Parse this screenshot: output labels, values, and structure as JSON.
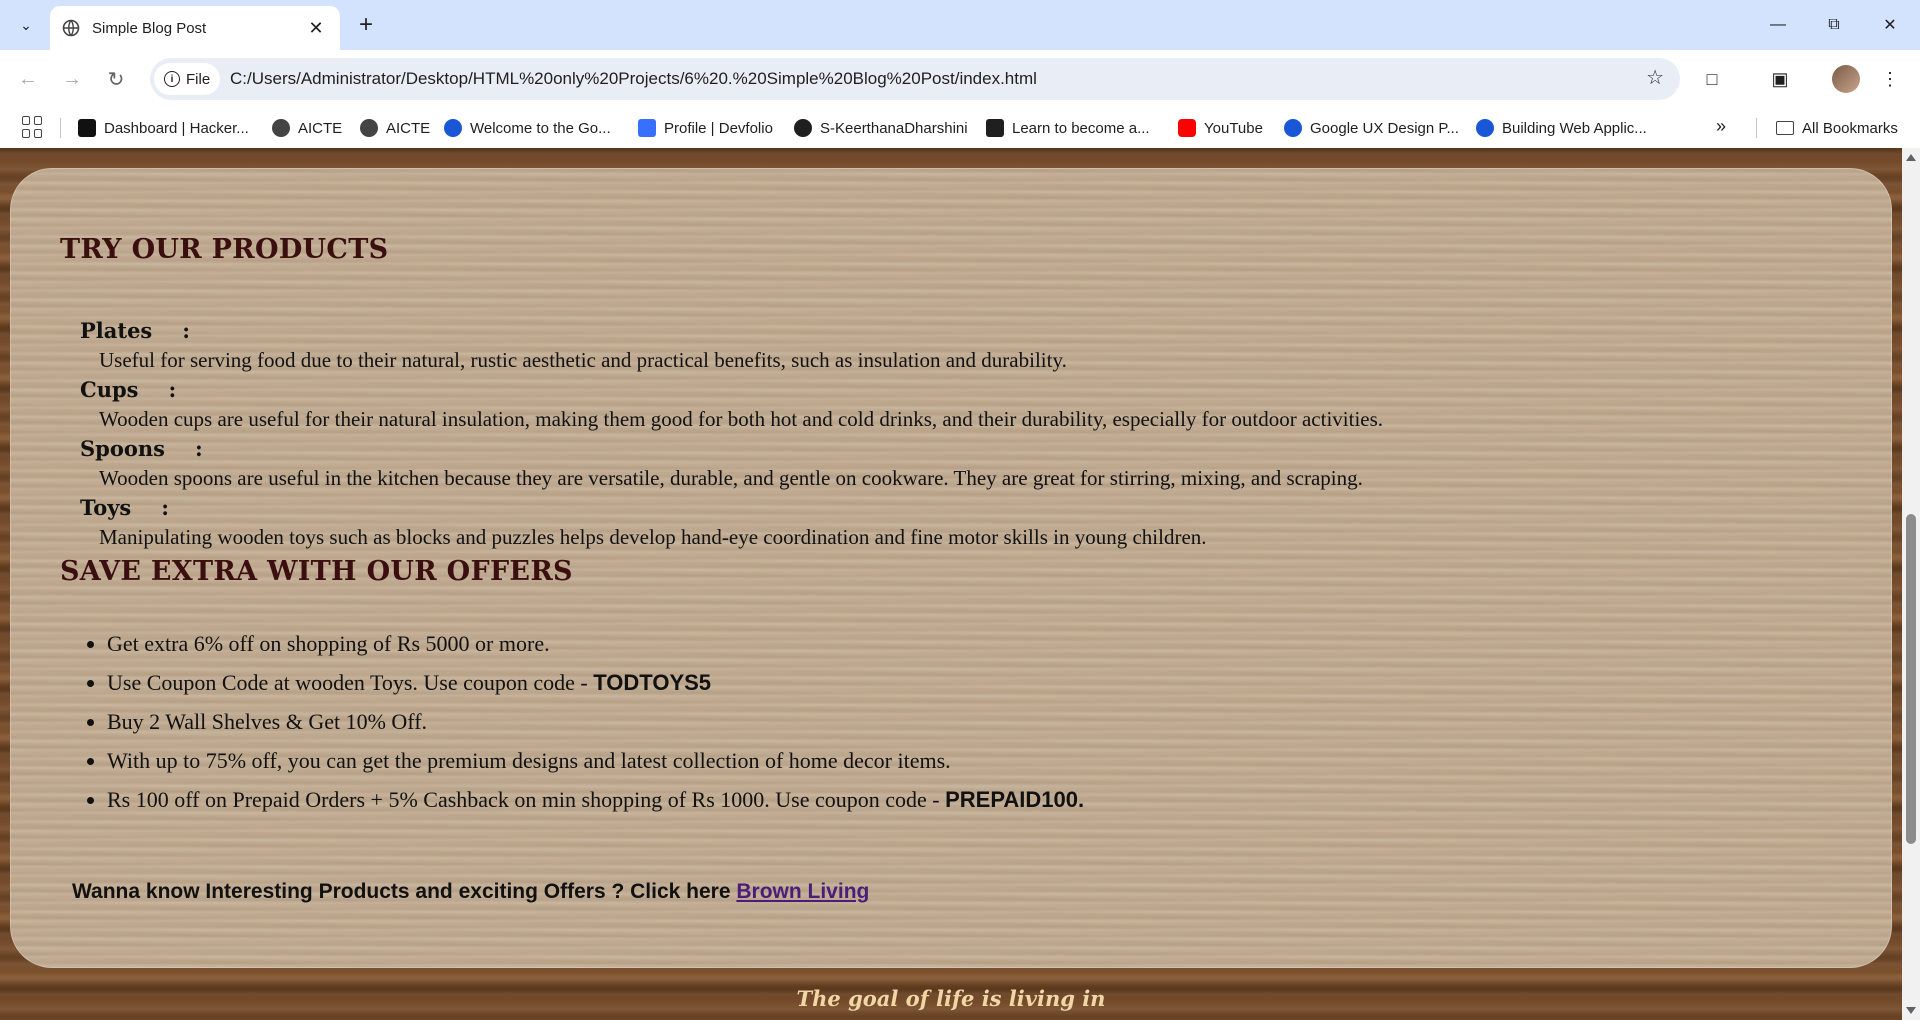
{
  "browser": {
    "tab_title": "Simple Blog Post",
    "address_chip": "File",
    "url": "C:/Users/Administrator/Desktop/HTML%20only%20Projects/6%20.%20Simple%20Blog%20Post/index.html",
    "bookmarks": [
      {
        "label": "Dashboard | Hacker...",
        "color": "#111111"
      },
      {
        "label": "AICTE",
        "color": "#444444"
      },
      {
        "label": "AICTE",
        "color": "#444444"
      },
      {
        "label": "Welcome to the Go...",
        "color": "#1a57d6"
      },
      {
        "label": "Profile | Devfolio",
        "color": "#3770ff"
      },
      {
        "label": "S-KeerthanaDharshini",
        "color": "#1f1f1f"
      },
      {
        "label": "Learn to become a...",
        "color": "#1f1f1f"
      },
      {
        "label": "YouTube",
        "color": "#ff0000"
      },
      {
        "label": "Google UX Design P...",
        "color": "#1a57d6"
      },
      {
        "label": "Building Web Applic...",
        "color": "#1a57d6"
      }
    ],
    "all_bookmarks": "All Bookmarks"
  },
  "page": {
    "products_heading": "TRY OUR PRODUCTS",
    "products": [
      {
        "name": "Plates",
        "colon": ":",
        "desc": "Useful for serving food due to their natural, rustic aesthetic and practical benefits, such as insulation and durability."
      },
      {
        "name": "Cups",
        "colon": ":",
        "desc": "Wooden cups are useful for their natural insulation, making them good for both hot and cold drinks, and their durability, especially for outdoor activities."
      },
      {
        "name": "Spoons",
        "colon": ":",
        "desc": "Wooden spoons are useful in the kitchen because they are versatile, durable, and gentle on cookware. They are great for stirring, mixing, and scraping."
      },
      {
        "name": "Toys",
        "colon": ":",
        "desc": "Manipulating wooden toys such as blocks and puzzles helps develop hand-eye coordination and fine motor skills in young children."
      }
    ],
    "offers_heading": "SAVE EXTRA WITH OUR OFFERS",
    "offers": [
      {
        "text": "Get extra 6% off on shopping of Rs 5000 or more.",
        "code": ""
      },
      {
        "text": "Use Coupon Code at wooden Toys. Use coupon code - ",
        "code": "TODTOYS5"
      },
      {
        "text": "Buy 2 Wall Shelves & Get 10% Off.",
        "code": ""
      },
      {
        "text": "With up to 75% off, you can get the premium designs and latest collection of home decor items.",
        "code": ""
      },
      {
        "text": "Rs 100 off on Prepaid Orders + 5% Cashback on min shopping of Rs 1000. Use coupon code - ",
        "code": "PREPAID100."
      }
    ],
    "cta_text": "Wanna know Interesting Products and exciting Offers ? Click here ",
    "cta_link": "Brown Living",
    "quote": "The goal of life is living in"
  }
}
